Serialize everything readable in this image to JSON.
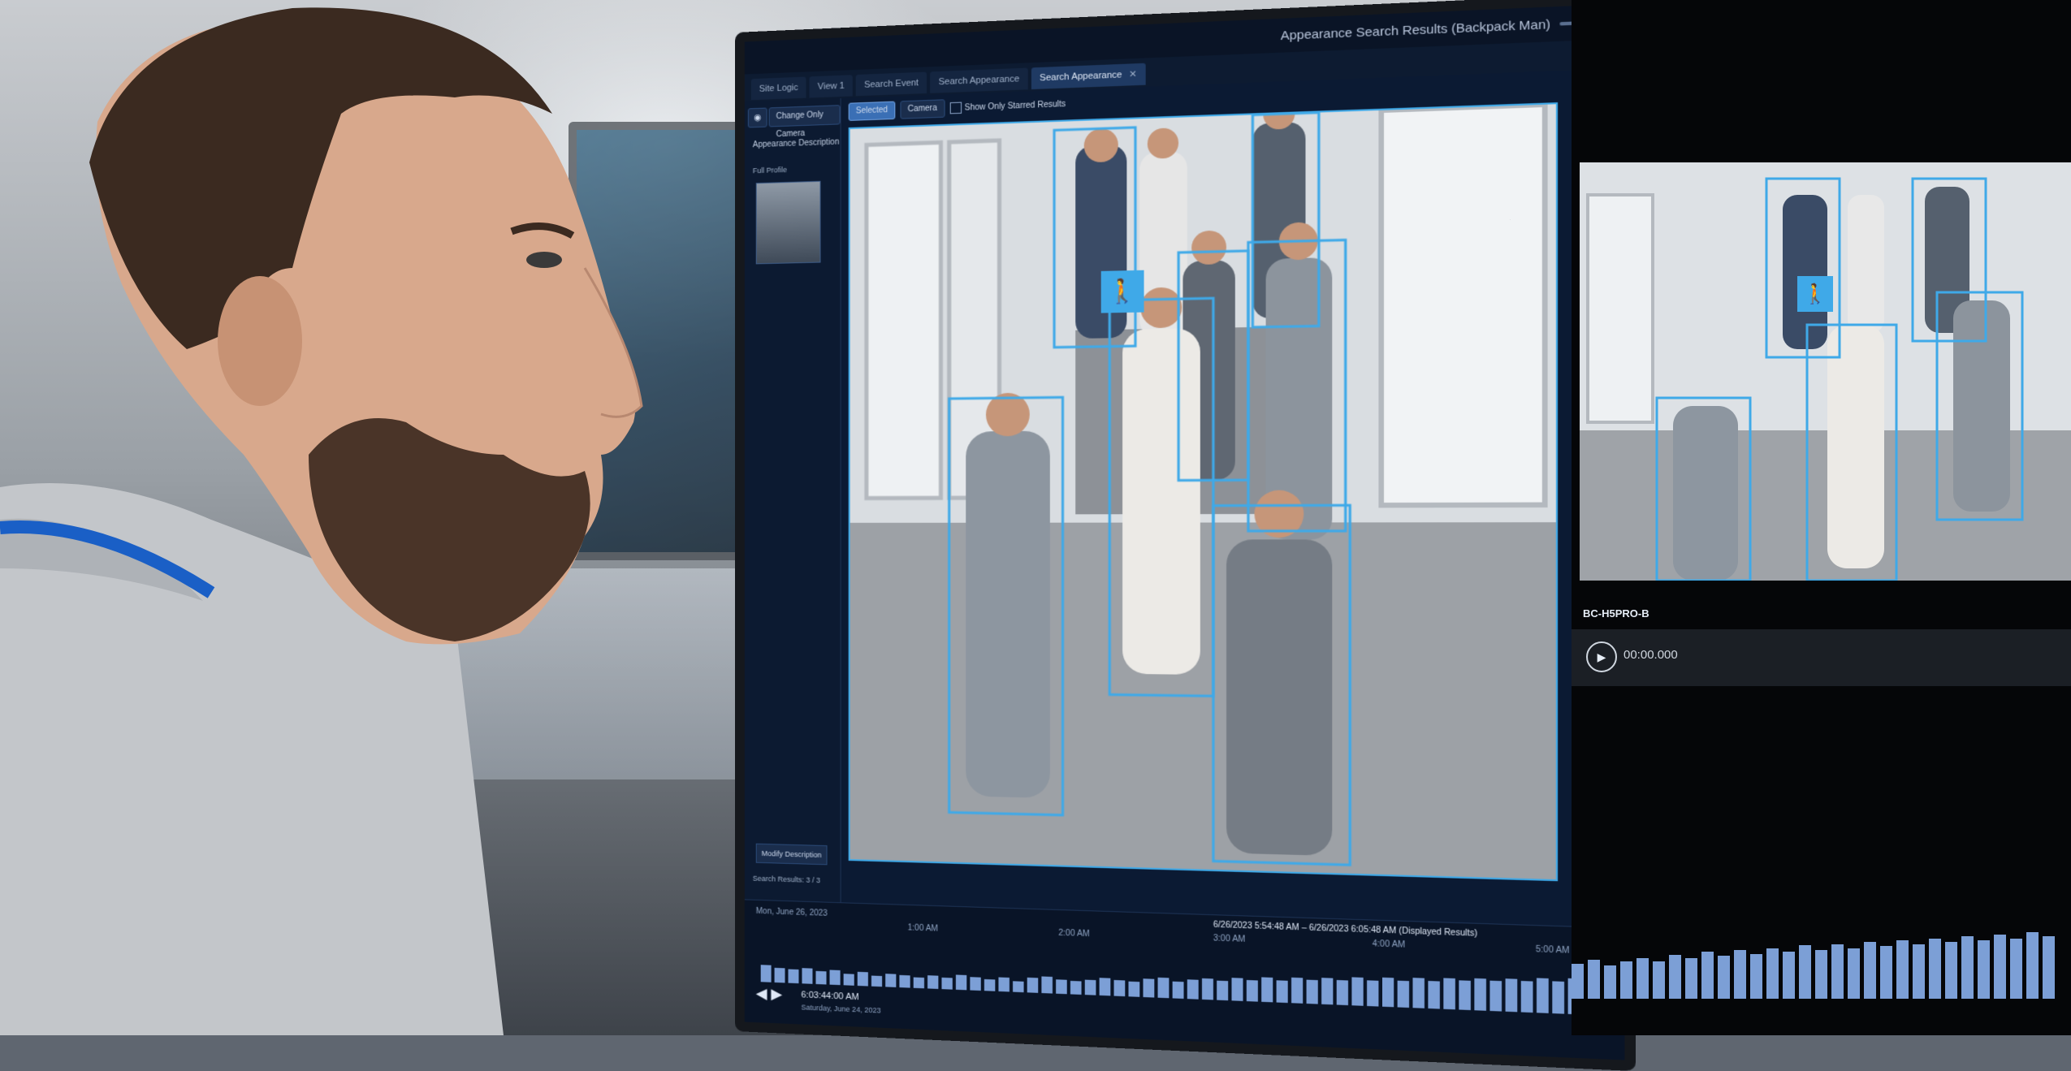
{
  "scene": {
    "description_free": true
  },
  "app": {
    "title": "Appearance Search Results (Backpack Man)",
    "tabs": [
      {
        "label": "Site Logic",
        "active": false
      },
      {
        "label": "View 1",
        "active": false
      },
      {
        "label": "Search Event",
        "active": false
      },
      {
        "label": "Search Appearance",
        "active": false
      },
      {
        "label": "Search Appearance",
        "active": true
      }
    ],
    "left_panel": {
      "change_camera": "Change Only Camera",
      "heading": "Appearance Description",
      "full_profile": "Full Profile",
      "modify_button": "Modify Description",
      "result_count": "Search Results: 3 / 3"
    },
    "filters": {
      "selected": "Selected",
      "camera": "Camera",
      "starred": "Show Only Starred Results"
    },
    "timeline": {
      "date": "Mon, June 26, 2023",
      "range": "6/26/2023 5:54:48 AM  –  6/26/2023 6:05:48 AM  (Displayed Results)",
      "ticks": [
        "1:00 AM",
        "2:00 AM",
        "3:00 AM",
        "4:00 AM",
        "5:00 AM"
      ],
      "time": "6:03:44:00 AM",
      "day": "Saturday, June 24, 2023",
      "bar_values": [
        0.35,
        0.3,
        0.28,
        0.32,
        0.26,
        0.3,
        0.24,
        0.28,
        0.22,
        0.26,
        0.25,
        0.22,
        0.27,
        0.24,
        0.3,
        0.26,
        0.24,
        0.28,
        0.22,
        0.3,
        0.33,
        0.28,
        0.26,
        0.3,
        0.35,
        0.32,
        0.3,
        0.36,
        0.4,
        0.34,
        0.38,
        0.42,
        0.38,
        0.45,
        0.42,
        0.48,
        0.44,
        0.5,
        0.46,
        0.52,
        0.48,
        0.55,
        0.5,
        0.56,
        0.52,
        0.58,
        0.54,
        0.6,
        0.56,
        0.62,
        0.58,
        0.64,
        0.6,
        0.66,
        0.62,
        0.68,
        0.64
      ]
    }
  },
  "side": {
    "camera_label": "BC-H5PRO-B",
    "time": "00:00.000"
  },
  "colors": {
    "accent": "#3fa9e8",
    "bar": "#7c9fd6"
  }
}
